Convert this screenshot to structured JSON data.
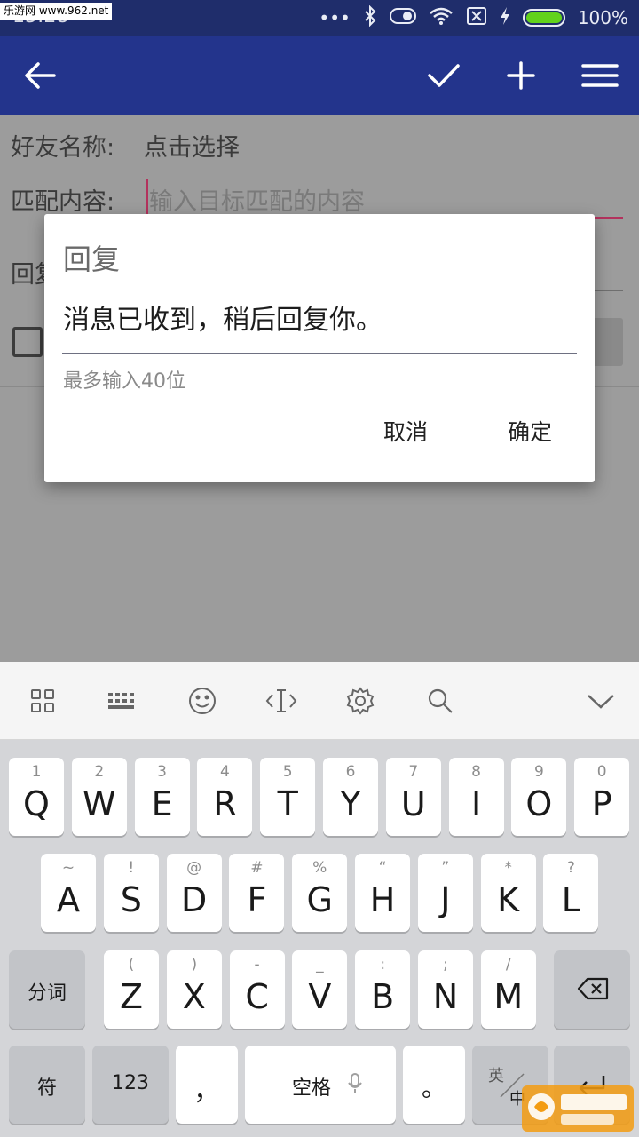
{
  "status_bar": {
    "watermark": "乐游网 www.962.net",
    "time": "15:28",
    "battery_text": "100%"
  },
  "form": {
    "friend_label": "好友名称:",
    "friend_value": "点击选择",
    "match_label": "匹配内容:",
    "match_placeholder": "输入目标匹配的内容",
    "reply_label_partial": "回复"
  },
  "dialog": {
    "title": "回复",
    "input_value": "消息已收到，稍后回复你。",
    "hint": "最多输入40位",
    "cancel": "取消",
    "confirm": "确定"
  },
  "keyboard": {
    "row1": [
      {
        "main": "Q",
        "sub": "1"
      },
      {
        "main": "W",
        "sub": "2"
      },
      {
        "main": "E",
        "sub": "3"
      },
      {
        "main": "R",
        "sub": "4"
      },
      {
        "main": "T",
        "sub": "5"
      },
      {
        "main": "Y",
        "sub": "6"
      },
      {
        "main": "U",
        "sub": "7"
      },
      {
        "main": "I",
        "sub": "8"
      },
      {
        "main": "O",
        "sub": "9"
      },
      {
        "main": "P",
        "sub": "0"
      }
    ],
    "row2": [
      {
        "main": "A",
        "sub": "~"
      },
      {
        "main": "S",
        "sub": "!"
      },
      {
        "main": "D",
        "sub": "@"
      },
      {
        "main": "F",
        "sub": "#"
      },
      {
        "main": "G",
        "sub": "%"
      },
      {
        "main": "H",
        "sub": "“"
      },
      {
        "main": "J",
        "sub": "”"
      },
      {
        "main": "K",
        "sub": "*"
      },
      {
        "main": "L",
        "sub": "?"
      }
    ],
    "row3": [
      {
        "main": "Z",
        "sub": "("
      },
      {
        "main": "X",
        "sub": ")"
      },
      {
        "main": "C",
        "sub": "-"
      },
      {
        "main": "V",
        "sub": "_"
      },
      {
        "main": "B",
        "sub": ":"
      },
      {
        "main": "N",
        "sub": ";"
      },
      {
        "main": "M",
        "sub": "/"
      }
    ],
    "segment_key": "分词",
    "symbol_key": "符",
    "number_key": "123",
    "comma_key": "，",
    "space_key": "空格",
    "period_key": "。",
    "lang_key_top": "英",
    "lang_key_bottom": "中"
  },
  "colors": {
    "app_bar": "#23348c",
    "accent": "#b3325d"
  }
}
